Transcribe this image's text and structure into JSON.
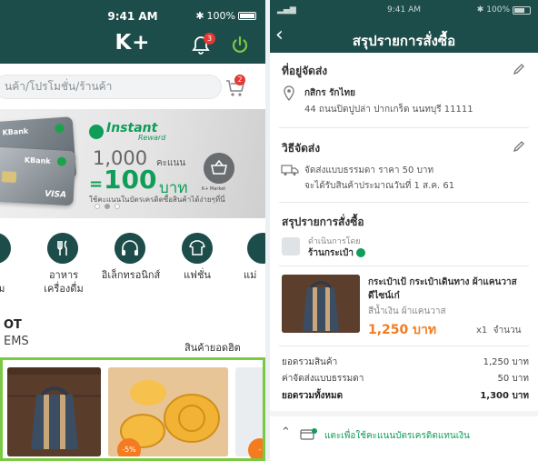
{
  "left": {
    "status_time": "9:41 AM",
    "status_battery": "100%",
    "logo": "K+",
    "notif_count": "3",
    "search_placeholder": "นค้า/โปรโมชั่น/ร้านค้า",
    "cart_count": "2",
    "banner": {
      "card_brand": "KBank",
      "card_network": "VISA",
      "badge_title": "Instant",
      "badge_sub": "Reward",
      "points_value": "1,000",
      "points_unit": "คะแนน",
      "equals": "=",
      "baht_value": "100",
      "baht_unit": "บาท",
      "note": "ใช้คะแนนในบัตรเครดิตซื้อสินค้าได้ง่ายๆที่นี่",
      "market_label": "K+ Market",
      "slide_count": 3,
      "active_slide": 1
    },
    "categories": [
      {
        "label": "พ\nาม",
        "icon": "partial-category-icon"
      },
      {
        "label": "อาหาร\nเครื่องดื่ม",
        "icon": "utensils-icon"
      },
      {
        "label": "อิเล็กทรอนิกส์",
        "icon": "headphones-icon"
      },
      {
        "label": "แฟชั่น",
        "icon": "shirt-icon"
      },
      {
        "label": "แม่",
        "icon": "partial-category-icon"
      }
    ],
    "section_title": "OT",
    "section_sub": "EMS",
    "section_link": "สินค้ายอดฮิต",
    "products": [
      {
        "name": "bag",
        "discount": ""
      },
      {
        "name": "mooncake",
        "discount": "-5%"
      },
      {
        "name": "partial",
        "discount": "-"
      }
    ]
  },
  "right": {
    "status_time": "9:41 AM",
    "status_battery": "100%",
    "title": "สรุปรายการสั่งซื้อ",
    "address": {
      "heading": "ที่อยู่จัดส่ง",
      "name": "กสิกร รักไทย",
      "line": "44 ถนนปิดปูปล่า ปากเกร็ด นนทบุรี 11111"
    },
    "shipping": {
      "heading": "วิธีจัดส่ง",
      "line1": "จัดส่งแบบธรรมดา ราคา 50 บาท",
      "line2": "จะได้รับสินค้าประมาณวันที่ 1 ส.ค. 61"
    },
    "summary_heading": "สรุปรายการสั่งซื้อ",
    "store": {
      "label": "ดำเนินการโดย",
      "name": "ร้านกระเป๋า"
    },
    "item": {
      "title_line1": "กระเป๋าเป้ กระเป๋าเดินทาง ผ้าแคนวาส",
      "title_line2": "ดีไซน์เก๋",
      "variant": "สีน้ำเงิน ผ้าแคนวาส",
      "price": "1,250 บาท",
      "qty": "x1",
      "qty_label": "จำนวน"
    },
    "totals": [
      {
        "label": "ยอดรวมสินค้า",
        "value": "1,250 บาท",
        "bold": false
      },
      {
        "label": "ค่าจัดส่งแบบธรรมดา",
        "value": "50 บาท",
        "bold": false
      },
      {
        "label": "ยอดรวมทั้งหมด",
        "value": "1,300 บาท",
        "bold": true
      }
    ],
    "points_toggle": "แตะเพื่อใช้คะแนนบัตรเครดิตแทนเงิน"
  },
  "colors": {
    "appbar": "#1d4d4a",
    "accent_green": "#0f9d58",
    "price_orange": "#f47b20",
    "highlight_border": "#7ac943",
    "badge_red": "#e53935"
  }
}
